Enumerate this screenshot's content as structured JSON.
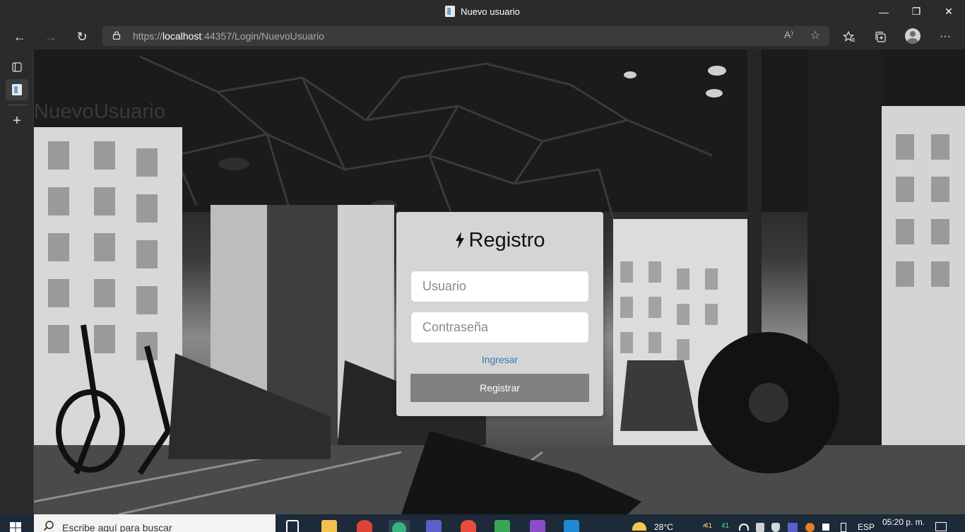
{
  "window": {
    "title": "Nuevo usuario",
    "minimize": "—",
    "restore": "❐",
    "close": "✕"
  },
  "browser": {
    "back": "←",
    "forward": "→",
    "refresh": "↻",
    "url_prefix": "https://",
    "url_host": "localhost",
    "url_rest": ":44357/Login/NuevoUsuario",
    "read_aloud": "A⁾",
    "add_favorite": "☆",
    "favorites": "☆",
    "collections": "⧉",
    "menu": "···"
  },
  "sidebar": {
    "tab_actions": "▢",
    "new_tab": "+"
  },
  "page": {
    "heading": "NuevoUsuario"
  },
  "form": {
    "title": "Registro",
    "username_placeholder": "Usuario",
    "password_placeholder": "Contraseña",
    "login_link": "Ingresar",
    "submit_label": "Registrar"
  },
  "taskbar": {
    "search_placeholder": "Escribe aquí para buscar",
    "weather": "28°C",
    "badge_1": "41",
    "badge_2": "41",
    "language": "ESP",
    "time": "05:20 p. m."
  },
  "colors": {
    "link": "#337ab7",
    "button": "#808080",
    "card": "#d5d5d5",
    "chrome": "#2b2b2b"
  }
}
